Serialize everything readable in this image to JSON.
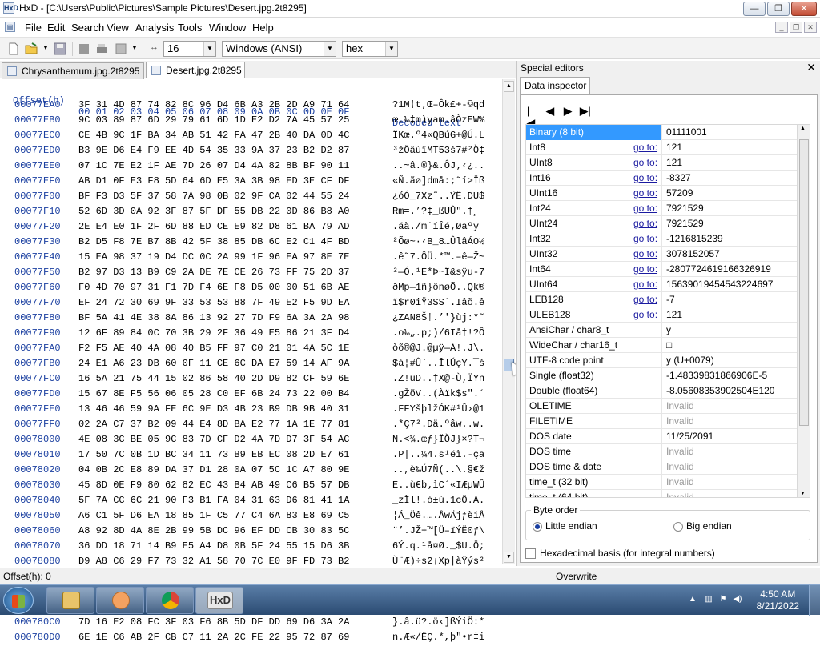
{
  "window": {
    "title": "HxD - [C:\\Users\\Public\\Pictures\\Sample Pictures\\Desert.jpg.2t8295]",
    "app_icon_label": "HxD",
    "caption_min": "—",
    "caption_max": "❐",
    "caption_close": "✕"
  },
  "menu": {
    "items": [
      "File",
      "Edit",
      "Search",
      "View",
      "Analysis",
      "Tools",
      "Window",
      "Help"
    ]
  },
  "toolbar": {
    "bytes_per_row": "16",
    "charset": "Windows (ANSI)",
    "offset_base": "hex"
  },
  "tabs": [
    "Chrysanthemum.jpg.2t8295",
    "Desert.jpg.2t8295"
  ],
  "hex": {
    "header_offset": "Offset(h)",
    "header_cols": "00 01 02 03 04 05 06 07 08 09 0A 0B 0C 0D 0E 0F",
    "header_text": "Decoded text",
    "rows": [
      {
        "o": "00077EA0",
        "h": "3F 31 4D 87 74 82 8C 96 D4 6B A3 2B 2D A9 71 64",
        "t": "?1M‡t‚Œ–Ôk£+-©qd"
      },
      {
        "o": "00077EB0",
        "h": "9C 03 89 87 6D 29 79 61 6D 1D E2 D2 7A 45 57 25",
        "t": "œ.‰‡m)yam.âÒzEW%"
      },
      {
        "o": "00077EC0",
        "h": "CE 4B 9C 1F BA 34 AB 51 42 FA 47 2B 40 DA 0D 4C",
        "t": "ÎKœ.º4«QBúG+@Ú.L"
      },
      {
        "o": "00077ED0",
        "h": "B3 9E D6 E4 F9 EE 4D 54 35 33 9A 37 23 B2 D2 87",
        "t": "³žÖäùîMT53š7#²Ò‡"
      },
      {
        "o": "00077EE0",
        "h": "07 1C 7E E2 1F AE 7D 26 07 D4 4A 82 8B BF 90 11",
        "t": "..~â.®}&.ÔJ‚‹¿.."
      },
      {
        "o": "00077EF0",
        "h": "AB D1 0F E3 F8 5D 64 6D E5 3A 3B 98 ED 3E CF DF",
        "t": "«Ñ.ãø]dmå:;˜í>Ïß"
      },
      {
        "o": "00077F00",
        "h": "BF F3 D3 5F 37 58 7A 98 0B 02 9F CA 02 44 55 24",
        "t": "¿óÓ_7Xz˜..ŸÊ.DU$"
      },
      {
        "o": "00077F10",
        "h": "52 6D 3D 0A 92 3F 87 5F DF 55 DB 22 0D 86 B8 A0",
        "t": "Rm=.’?‡_ßUÛ\".†¸ "
      },
      {
        "o": "00077F20",
        "h": "2E E4 E0 1F 2F 6D 88 ED CE E9 82 D8 61 BA 79 AD",
        "t": ".äà./mˆíÎé‚Øaºy­"
      },
      {
        "o": "00077F30",
        "h": "B2 D5 F8 7E B7 8B 42 5F 38 85 DB 6C E2 C1 4F BD",
        "t": "²Õø~·‹B_8…ÛlâÁO½"
      },
      {
        "o": "00077F40",
        "h": "15 EA 98 37 19 D4 DC 0C 2A 99 1F 96 EA 97 8E 7E",
        "t": ".ê˜7.ÔÜ.*™.–ê—Ž~"
      },
      {
        "o": "00077F50",
        "h": "B2 97 D3 13 B9 C9 2A DE 7E CE 26 73 FF 75 2D 37",
        "t": "²—Ó.¹É*Þ~Î&sÿu-7"
      },
      {
        "o": "00077F60",
        "h": "F0 4D 70 97 31 F1 7D F4 6E F8 D5 00 00 51 6B AE",
        "t": "ðMp—1ñ}ônøÕ..Qk®"
      },
      {
        "o": "00077F70",
        "h": "EF 24 72 30 69 9F 33 53 53 88 7F 49 E2 F5 9D EA",
        "t": "ï$r0iŸ3SSˆ.Iâõ.ê"
      },
      {
        "o": "00077F80",
        "h": "BF 5A 41 4E 38 8A 86 13 92 27 7D F9 6A 3A 2A 98",
        "t": "¿ZAN8Š†.’'}ùj:*˜"
      },
      {
        "o": "00077F90",
        "h": "12 6F 89 84 0C 70 3B 29 2F 36 49 E5 86 21 3F D4",
        "t": ".o‰„.p;)/6Iå†!?Ô"
      },
      {
        "o": "00077FA0",
        "h": "F2 F5 AE 40 4A 08 40 B5 FF 97 C0 21 01 4A 5C 1E",
        "t": "òõ®@J.@µÿ—À!.J\\."
      },
      {
        "o": "00077FB0",
        "h": "24 E1 A6 23 DB 60 0F 11 CE 6C DA E7 59 14 AF 9A",
        "t": "$á¦#Û`..ÎlÚçY.¯š"
      },
      {
        "o": "00077FC0",
        "h": "16 5A 21 75 44 15 02 86 58 40 2D D9 82 CF 59 6E",
        "t": ".Z!uD..†X@-Ù‚ÏYn"
      },
      {
        "o": "00077FD0",
        "h": "15 67 8E F5 56 06 05 28 C0 EF 6B 24 73 22 00 B4",
        "t": ".gŽõV..(Àïk$s\".´"
      },
      {
        "o": "00077FE0",
        "h": "13 46 46 59 9A FE 6C 9E D3 4B 23 B9 DB 9B 40 31",
        "t": ".FFYšþlžÓK#¹Û›@1"
      },
      {
        "o": "00077FF0",
        "h": "02 2A C7 37 B2 09 44 E4 8D BA E2 77 1A 1E 77 81",
        "t": ".*Ç7².Dä.ºâw..w."
      },
      {
        "o": "00078000",
        "h": "4E 08 3C BE 05 9C 83 7D CF D2 4A 7D D7 3F 54 AC",
        "t": "N.<¾.œƒ}ÏÒJ}×?T¬"
      },
      {
        "o": "00078010",
        "h": "17 50 7C 0B 1D BC 34 11 73 B9 EB EC 08 2D E7 61",
        "t": ".P|..¼4.s¹ëì.-ça"
      },
      {
        "o": "00078020",
        "h": "04 0B 2C E8 89 DA 37 D1 28 0A 07 5C 1C A7 80 9E",
        "t": "..,è‰Ú7Ñ(..\\.§€ž"
      },
      {
        "o": "00078030",
        "h": "45 8D 0E F9 80 62 82 EC 43 B4 AB 49 C6 B5 57 DB",
        "t": "E..ù€b‚ìC´«IÆµWÛ"
      },
      {
        "o": "00078040",
        "h": "5F 7A CC 6C 21 90 F3 B1 FA 04 31 63 D6 81 41 1A",
        "t": "_zÌl!.ó±ú.1cÖ.A."
      },
      {
        "o": "00078050",
        "h": "A6 C1 5F D6 EA 18 85 1F C5 77 C4 6A 83 E8 69 C5",
        "t": "¦Á_Öê.….ÅwÄjƒèiÅ"
      },
      {
        "o": "00078060",
        "h": "A8 92 8D 4A 8E 2B 99 5B DC 96 EF DD CB 30 83 5C",
        "t": "¨’.JŽ+™[Ü–ïÝË0ƒ\\"
      },
      {
        "o": "00078070",
        "h": "36 DD 18 71 14 B9 E5 A4 D8 0B 5F 24 55 15 D6 3B",
        "t": "6Ý.q.¹å¤Ø._$U.Ö;"
      },
      {
        "o": "00078080",
        "h": "D9 A8 C6 29 F7 73 32 A1 58 70 7C E0 9F FD 73 B2",
        "t": "Ù¨Æ)÷s2¡Xp|àŸýs²"
      },
      {
        "o": "00078090",
        "h": "7A 4B A8 F7 A9 6D 78 B5 E9 56 BB 12 66 0B D1 AD",
        "t": "zK¨÷©mxµéV».f.Ñ­"
      },
      {
        "o": "000780A0",
        "h": "19 30 66 2F EB 1E 42 80 B6 7B A0 6E 42 D2 1D 3F",
        "t": ".0f/ë.B€¶{ nBÒ.?"
      },
      {
        "o": "000780B0",
        "h": "F2 B5 FA 54 A9 F0 13 D6 76 E9 0F 80 D5 06 51 E2",
        "t": "òµúT©ð.Övé.€Õ.Qâ"
      },
      {
        "o": "000780C0",
        "h": "7D 16 E2 08 FC 3F 03 F6 8B 5D DF DD 69 D6 3A 2A",
        "t": "}.â.ü?.ö‹]ßÝiÖ:*"
      },
      {
        "o": "000780D0",
        "h": "6E 1E C6 AB 2F CB C7 11 2A 2C FE 22 95 72 87 69",
        "t": "n.Æ«/ËÇ.*,þ\"•r‡i"
      }
    ]
  },
  "special_editors": {
    "title": "Special editors",
    "close": "✕",
    "tab": "Data inspector",
    "nav": [
      "|◀",
      "◀",
      "▶",
      "▶|"
    ],
    "goto_label": "go to:",
    "rows": [
      {
        "name": "Binary (8 bit)",
        "goto": false,
        "value": "01111001",
        "selected": true
      },
      {
        "name": "Int8",
        "goto": true,
        "value": "121"
      },
      {
        "name": "UInt8",
        "goto": true,
        "value": "121"
      },
      {
        "name": "Int16",
        "goto": true,
        "value": "-8327"
      },
      {
        "name": "UInt16",
        "goto": true,
        "value": "57209"
      },
      {
        "name": "Int24",
        "goto": true,
        "value": "7921529"
      },
      {
        "name": "UInt24",
        "goto": true,
        "value": "7921529"
      },
      {
        "name": "Int32",
        "goto": true,
        "value": "-1216815239"
      },
      {
        "name": "UInt32",
        "goto": true,
        "value": "3078152057"
      },
      {
        "name": "Int64",
        "goto": true,
        "value": "-2807724619166326919"
      },
      {
        "name": "UInt64",
        "goto": true,
        "value": "15639019454543224697"
      },
      {
        "name": "LEB128",
        "goto": true,
        "value": "-7"
      },
      {
        "name": "ULEB128",
        "goto": true,
        "value": "121"
      },
      {
        "name": "AnsiChar / char8_t",
        "goto": false,
        "value": "y"
      },
      {
        "name": "WideChar / char16_t",
        "goto": false,
        "value": "□"
      },
      {
        "name": "UTF-8 code point",
        "goto": false,
        "value": "y (U+0079)"
      },
      {
        "name": "Single (float32)",
        "goto": false,
        "value": "-1.48339831866906E-5"
      },
      {
        "name": "Double (float64)",
        "goto": false,
        "value": "-8.05608353902504E120"
      },
      {
        "name": "OLETIME",
        "goto": false,
        "value": "Invalid",
        "invalid": true
      },
      {
        "name": "FILETIME",
        "goto": false,
        "value": "Invalid",
        "invalid": true
      },
      {
        "name": "DOS date",
        "goto": false,
        "value": "11/25/2091"
      },
      {
        "name": "DOS time",
        "goto": false,
        "value": "Invalid",
        "invalid": true
      },
      {
        "name": "DOS time & date",
        "goto": false,
        "value": "Invalid",
        "invalid": true
      },
      {
        "name": "time_t (32 bit)",
        "goto": false,
        "value": "Invalid",
        "invalid": true
      },
      {
        "name": "time_t (64 bit)",
        "goto": false,
        "value": "Invalid",
        "invalid": true
      }
    ],
    "byte_order_label": "Byte order",
    "little_endian": "Little endian",
    "big_endian": "Big endian",
    "hex_basis": "Hexadecimal basis (for integral numbers)"
  },
  "statusbar": {
    "offset": "Offset(h): 0",
    "mode": "Overwrite"
  },
  "taskbar": {
    "time": "4:50 AM",
    "date": "8/21/2022",
    "hxd_label": "HxD"
  }
}
